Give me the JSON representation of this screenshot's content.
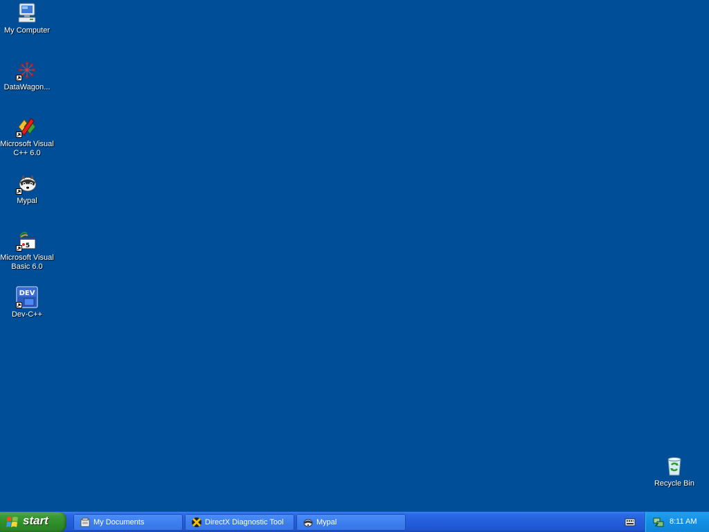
{
  "desktop": {
    "background_color": "#004e98",
    "icons": [
      {
        "label": "My Computer",
        "icon": "my-computer-icon"
      },
      {
        "label": "DataWagon...",
        "icon": "datawagon-icon"
      },
      {
        "label": "Microsoft Visual C++ 6.0",
        "icon": "visual-cpp-icon"
      },
      {
        "label": "Mypal",
        "icon": "mypal-icon"
      },
      {
        "label": "Microsoft Visual Basic 6.0",
        "icon": "visual-basic-icon"
      },
      {
        "label": "Dev-C++",
        "icon": "dev-cpp-icon"
      },
      {
        "label": "Recycle Bin",
        "icon": "recycle-bin-icon"
      }
    ]
  },
  "taskbar": {
    "start_label": "start",
    "tasks": [
      {
        "label": "My Documents",
        "icon": "folder-icon"
      },
      {
        "label": "DirectX Diagnostic Tool",
        "icon": "directx-icon"
      },
      {
        "label": "Mypal",
        "icon": "mypal-icon"
      }
    ],
    "tray": {
      "clock": "8:11 AM"
    }
  }
}
